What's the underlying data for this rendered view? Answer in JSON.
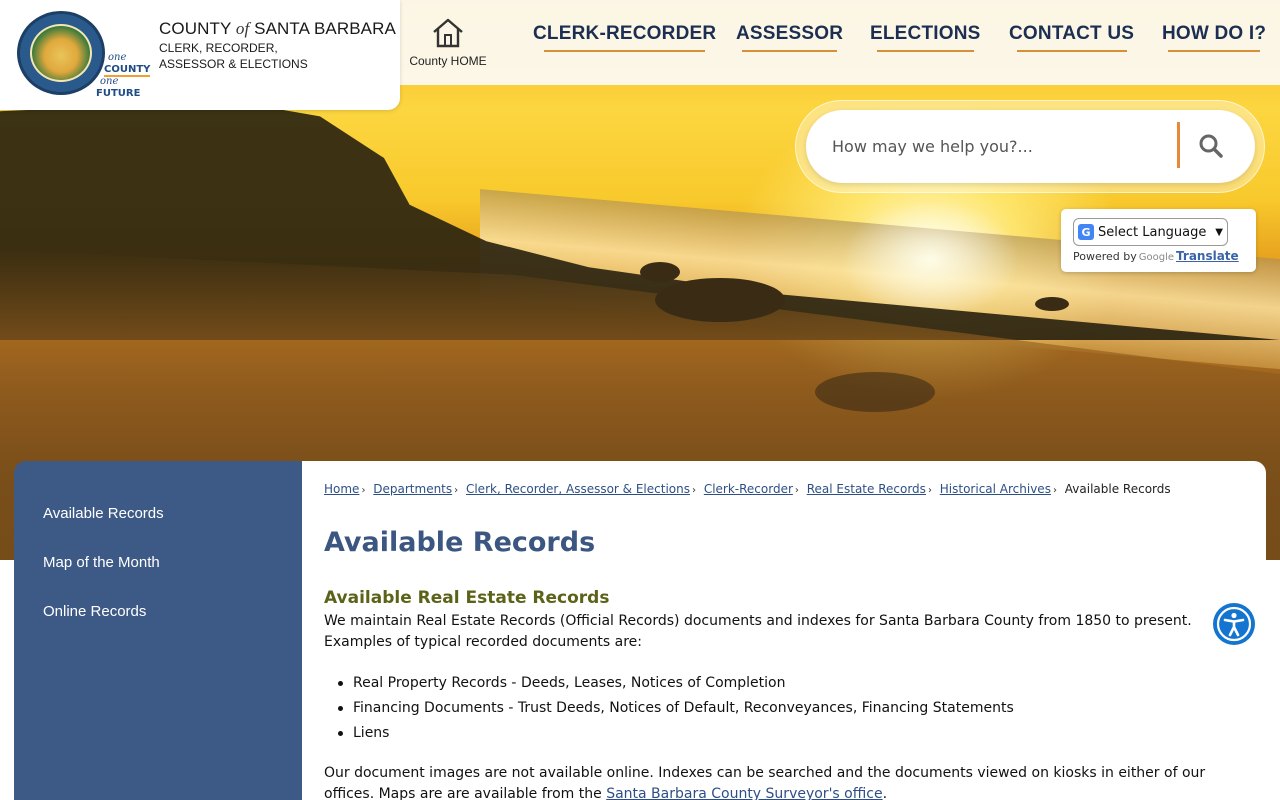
{
  "header": {
    "org_title_prefix": "COUNTY ",
    "org_title_of": "of",
    "org_title_suffix": " SANTA BARBARA",
    "org_subtitle_line1": "CLERK, RECORDER,",
    "org_subtitle_line2": "ASSESSOR & ELECTIONS",
    "tagline": {
      "line1": "one",
      "line2": "COUNTY",
      "line3": "one",
      "line4": "FUTURE"
    },
    "home_label": "County HOME",
    "nav": [
      {
        "label": "CLERK-RECORDER"
      },
      {
        "label": "ASSESSOR"
      },
      {
        "label": "ELECTIONS"
      },
      {
        "label": "CONTACT US"
      },
      {
        "label": "HOW DO I?"
      }
    ]
  },
  "search": {
    "placeholder": "How may we help you?..."
  },
  "translate": {
    "select_label": "Select Language",
    "powered_by": "Powered by",
    "google": "Google",
    "translate_link": "Translate"
  },
  "sidebar": {
    "items": [
      {
        "label": "Available Records"
      },
      {
        "label": "Map of the Month"
      },
      {
        "label": "Online Records"
      }
    ]
  },
  "breadcrumb": {
    "links": [
      "Home",
      "Departments",
      "Clerk, Recorder, Assessor & Elections",
      "Clerk-Recorder",
      "Real Estate Records",
      "Historical Archives"
    ],
    "current": "Available Records"
  },
  "content": {
    "page_title": "Available Records",
    "section_title": "Available Real Estate Records",
    "intro": "We maintain Real Estate Records (Official Records) documents and indexes for Santa Barbara County from 1850 to present. Examples of typical recorded documents are:",
    "list": [
      "Real Property Records - Deeds, Leases, Notices of Completion",
      "Financing Documents - Trust Deeds, Notices of Default, Reconveyances, Financing Statements",
      "Liens"
    ],
    "para2_text": "Our document images are not available online. Indexes can be searched and the documents viewed on kiosks in either of our offices. Maps are are available from the ",
    "para2_link": "Santa Barbara County Surveyor's office",
    "para2_end": "."
  },
  "colors": {
    "nav_text": "#1c2f52",
    "nav_underline": "#d98e3a",
    "sidebar_bg": "#3d5a87",
    "title": "#3b5680",
    "section_title": "#5c6318",
    "link": "#2d4f86",
    "accessibility": "#1475d1"
  },
  "icons": [
    "house-icon",
    "search-icon",
    "google-translate-icon",
    "accessibility-icon",
    "county-seal"
  ]
}
